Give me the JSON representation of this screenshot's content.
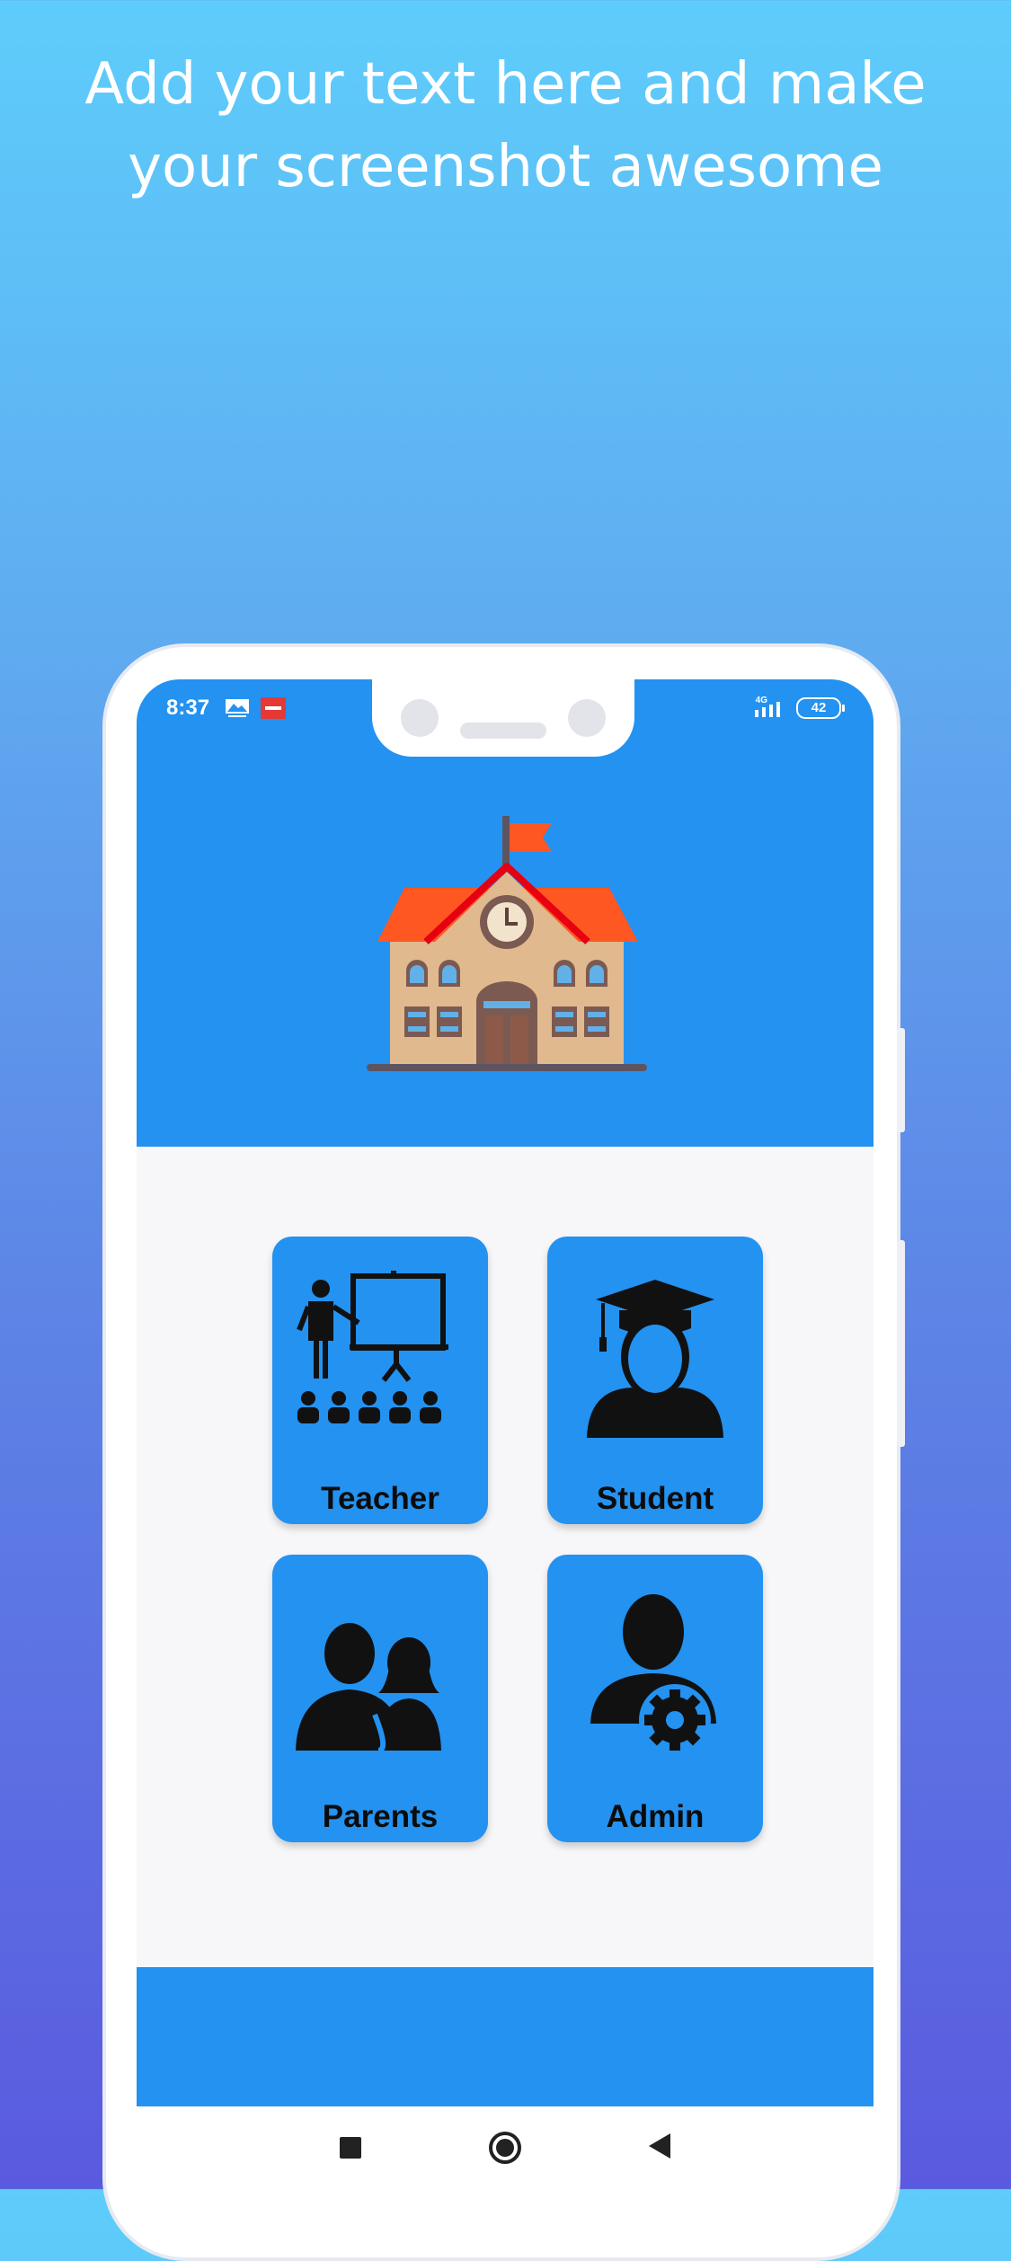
{
  "promo": {
    "line1": "Add your text here and make",
    "line2": "your screenshot awesome"
  },
  "status_bar": {
    "time": "8:37",
    "network": "4G",
    "battery": "42"
  },
  "header": {
    "logo_icon": "school-building-icon"
  },
  "roles": [
    {
      "label": "Teacher",
      "icon": "teacher-icon"
    },
    {
      "label": "Student",
      "icon": "graduate-icon"
    },
    {
      "label": "Parents",
      "icon": "parents-icon"
    },
    {
      "label": "Admin",
      "icon": "admin-gear-icon"
    }
  ],
  "nav": {
    "recent_icon": "square-icon",
    "home_icon": "circle-icon",
    "back_icon": "triangle-back-icon"
  },
  "colors": {
    "primary": "#2392f1",
    "background": "#f7f7f9",
    "roof": "#ff5722"
  }
}
